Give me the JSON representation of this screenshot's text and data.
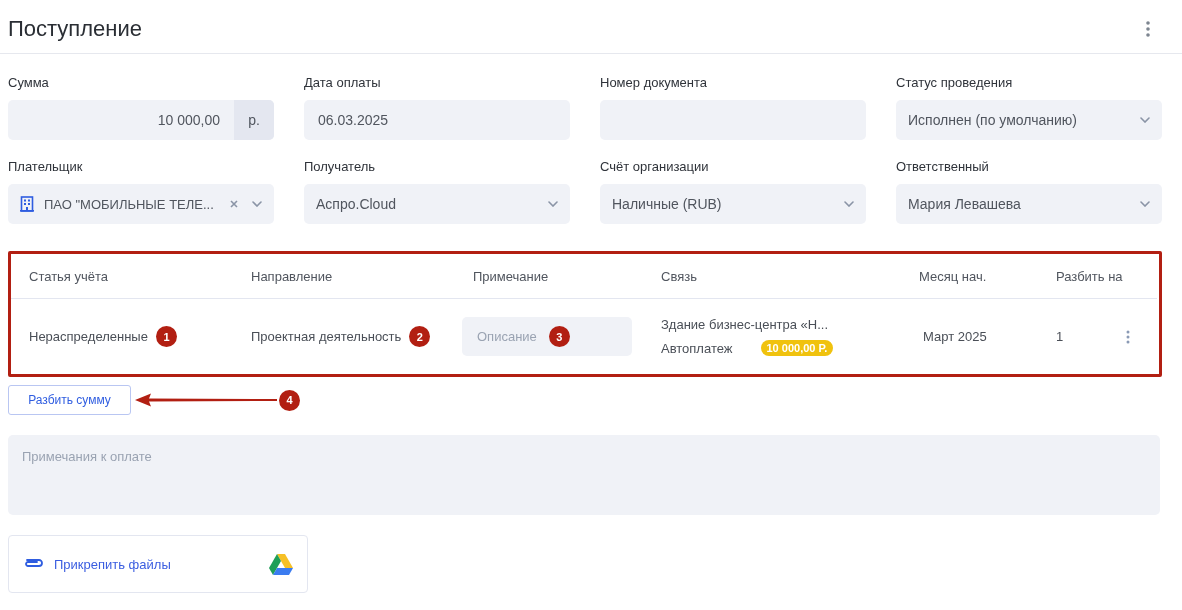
{
  "title": "Поступление",
  "fields": [
    {
      "kind": "amount",
      "label": "Сумма",
      "value": "10 000,00",
      "unit": "р."
    },
    {
      "kind": "text",
      "label": "Дата оплаты",
      "value": "06.03.2025"
    },
    {
      "kind": "text",
      "label": "Номер документа"
    },
    {
      "kind": "select",
      "label": "Статус проведения",
      "value": "Исполнен (по умолчанию)"
    },
    {
      "kind": "entity",
      "label": "Плательщик",
      "value": "ПАО \"МОБИЛЬНЫЕ ТЕЛЕ..."
    },
    {
      "kind": "select",
      "label": "Получатель",
      "value": "Аспро.Cloud"
    },
    {
      "kind": "select",
      "label": "Счёт организации",
      "value": "Наличные (RUB)"
    },
    {
      "kind": "select",
      "label": "Ответственный",
      "value": "Мария Левашева"
    }
  ],
  "table": {
    "columns": [
      "Статья учёта",
      "Направление",
      "Примечание",
      "Связь",
      "Месяц нач.",
      "Разбить на"
    ],
    "rows": [
      {
        "account": {
          "text": "Нераспределенные",
          "marker": "1"
        },
        "direction": {
          "text": "Проектная деятельность",
          "marker": "2"
        },
        "note": {
          "placeholder": "Описание",
          "marker": "3"
        },
        "link": {
          "title": "Здание бизнес-центра «Н...",
          "subtitle": "Автоплатеж",
          "badge": "10 000,00 Р."
        },
        "month": "Март 2025",
        "split": "1"
      }
    ]
  },
  "split_button": {
    "label": "Разбить сумму",
    "marker": "4"
  },
  "notes": {
    "placeholder": "Примечания к оплате"
  },
  "attach": {
    "label": "Прикрепить файлы"
  }
}
